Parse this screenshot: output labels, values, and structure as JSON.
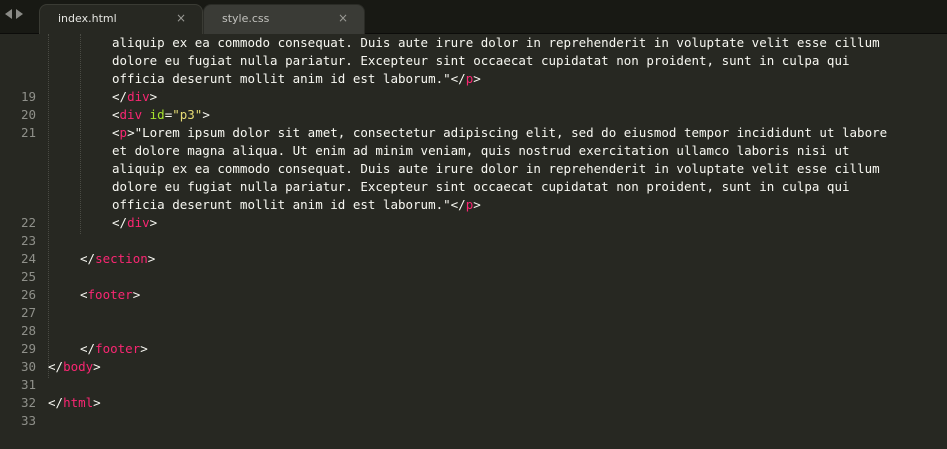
{
  "tabs": [
    {
      "label": "index.html",
      "close": "×",
      "active": true
    },
    {
      "label": "style.css",
      "close": "×",
      "active": false
    }
  ],
  "gutter": [
    {
      "row": 0,
      "num": ""
    },
    {
      "row": 1,
      "num": ""
    },
    {
      "row": 2,
      "num": ""
    },
    {
      "row": 3,
      "num": "19"
    },
    {
      "row": 4,
      "num": "20"
    },
    {
      "row": 5,
      "num": "21"
    },
    {
      "row": 6,
      "num": ""
    },
    {
      "row": 7,
      "num": ""
    },
    {
      "row": 8,
      "num": ""
    },
    {
      "row": 9,
      "num": ""
    },
    {
      "row": 10,
      "num": "22"
    },
    {
      "row": 11,
      "num": "23"
    },
    {
      "row": 12,
      "num": "24"
    },
    {
      "row": 13,
      "num": "25"
    },
    {
      "row": 14,
      "num": "26"
    },
    {
      "row": 15,
      "num": "27"
    },
    {
      "row": 16,
      "num": "28"
    },
    {
      "row": 17,
      "num": "29"
    },
    {
      "row": 18,
      "num": "30"
    },
    {
      "row": 19,
      "num": "31"
    },
    {
      "row": 20,
      "num": "32"
    },
    {
      "row": 21,
      "num": "33"
    }
  ],
  "code": [
    {
      "row": 0,
      "indent": 2,
      "parts": [
        [
          "text",
          "aliquip ex ea commodo consequat. Duis aute irure dolor in reprehenderit in voluptate velit esse cillum"
        ]
      ]
    },
    {
      "row": 1,
      "indent": 2,
      "parts": [
        [
          "text",
          "dolore eu fugiat nulla pariatur. Excepteur sint occaecat cupidatat non proident, sunt in culpa qui"
        ]
      ]
    },
    {
      "row": 2,
      "indent": 2,
      "parts": [
        [
          "text",
          "officia deserunt mollit anim id est laborum.\""
        ],
        [
          "punc",
          "</"
        ],
        [
          "tag",
          "p"
        ],
        [
          "punc",
          ">"
        ]
      ]
    },
    {
      "row": 3,
      "indent": 2,
      "parts": [
        [
          "punc",
          "</"
        ],
        [
          "tag",
          "div"
        ],
        [
          "punc",
          ">"
        ]
      ]
    },
    {
      "row": 4,
      "indent": 2,
      "parts": [
        [
          "punc",
          "<"
        ],
        [
          "tag",
          "div"
        ],
        [
          "text",
          " "
        ],
        [
          "attr",
          "id"
        ],
        [
          "punc",
          "="
        ],
        [
          "str",
          "\"p3\""
        ],
        [
          "punc",
          ">"
        ]
      ]
    },
    {
      "row": 5,
      "indent": 2,
      "parts": [
        [
          "punc",
          "<"
        ],
        [
          "tag",
          "p"
        ],
        [
          "punc",
          ">"
        ],
        [
          "text",
          "\"Lorem ipsum dolor sit amet, consectetur adipiscing elit, sed do eiusmod tempor incididunt ut labore"
        ]
      ]
    },
    {
      "row": 6,
      "indent": 2,
      "parts": [
        [
          "text",
          "et dolore magna aliqua. Ut enim ad minim veniam, quis nostrud exercitation ullamco laboris nisi ut"
        ]
      ]
    },
    {
      "row": 7,
      "indent": 2,
      "parts": [
        [
          "text",
          "aliquip ex ea commodo consequat. Duis aute irure dolor in reprehenderit in voluptate velit esse cillum"
        ]
      ]
    },
    {
      "row": 8,
      "indent": 2,
      "parts": [
        [
          "text",
          "dolore eu fugiat nulla pariatur. Excepteur sint occaecat cupidatat non proident, sunt in culpa qui"
        ]
      ]
    },
    {
      "row": 9,
      "indent": 2,
      "parts": [
        [
          "text",
          "officia deserunt mollit anim id est laborum.\""
        ],
        [
          "punc",
          "</"
        ],
        [
          "tag",
          "p"
        ],
        [
          "punc",
          ">"
        ]
      ]
    },
    {
      "row": 10,
      "indent": 2,
      "parts": [
        [
          "punc",
          "</"
        ],
        [
          "tag",
          "div"
        ],
        [
          "punc",
          ">"
        ]
      ]
    },
    {
      "row": 12,
      "indent": 1,
      "parts": [
        [
          "punc",
          "</"
        ],
        [
          "tag",
          "section"
        ],
        [
          "punc",
          ">"
        ]
      ]
    },
    {
      "row": 14,
      "indent": 1,
      "parts": [
        [
          "punc",
          "<"
        ],
        [
          "tag",
          "footer"
        ],
        [
          "punc",
          ">"
        ]
      ]
    },
    {
      "row": 17,
      "indent": 1,
      "parts": [
        [
          "punc",
          "</"
        ],
        [
          "tag",
          "footer"
        ],
        [
          "punc",
          ">"
        ]
      ]
    },
    {
      "row": 18,
      "indent": 0,
      "parts": [
        [
          "punc",
          "</"
        ],
        [
          "tag",
          "body"
        ],
        [
          "punc",
          ">"
        ]
      ]
    },
    {
      "row": 20,
      "indent": 0,
      "parts": [
        [
          "punc",
          "</"
        ],
        [
          "tag",
          "html"
        ],
        [
          "punc",
          ">"
        ]
      ]
    }
  ],
  "colors": {
    "background": "#272822",
    "tag": "#f92672",
    "attribute": "#a6e22e",
    "string": "#e6db74",
    "text": "#f8f8f2",
    "gutter": "#8f908a"
  }
}
